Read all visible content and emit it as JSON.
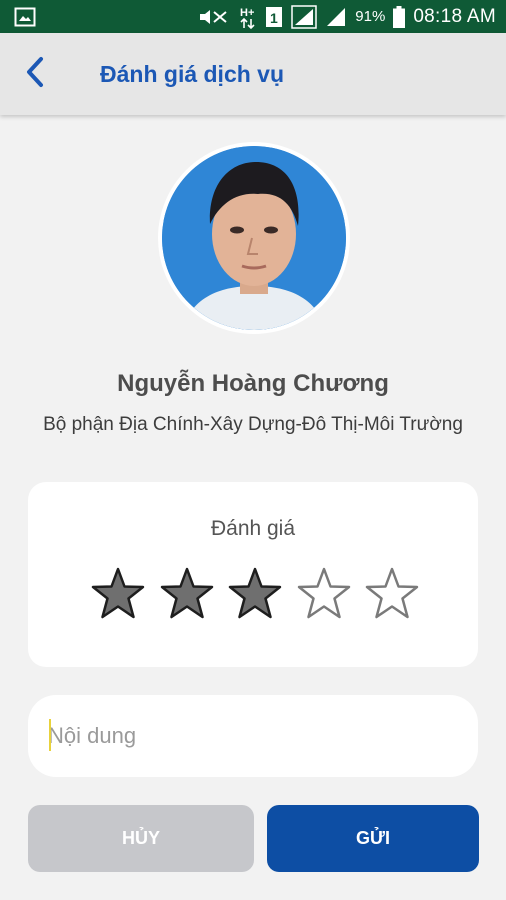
{
  "status_bar": {
    "battery_percent": "91%",
    "time": "08:18 AM",
    "icons": [
      "gallery-icon",
      "mute-icon",
      "hplus-data-icon",
      "sim1-icon",
      "signal-icon",
      "signal-icon-2",
      "battery-icon"
    ],
    "background": "#0f5a36"
  },
  "header": {
    "title": "Đánh giá dịch vụ",
    "back_icon": "back-arrow-icon",
    "title_color": "#1c58b5"
  },
  "profile": {
    "name": "Nguyễn Hoàng Chương",
    "department": "Bộ phận Địa Chính-Xây Dựng-Đô Thị-Môi Trường"
  },
  "rating": {
    "label": "Đánh giá",
    "value": 3,
    "max": 5
  },
  "content": {
    "placeholder": "Nội dung",
    "value": ""
  },
  "actions": {
    "cancel_label": "HỦY",
    "send_label": "GỬI",
    "cancel_color": "#c6c7cb",
    "send_color": "#0d4ea4"
  }
}
